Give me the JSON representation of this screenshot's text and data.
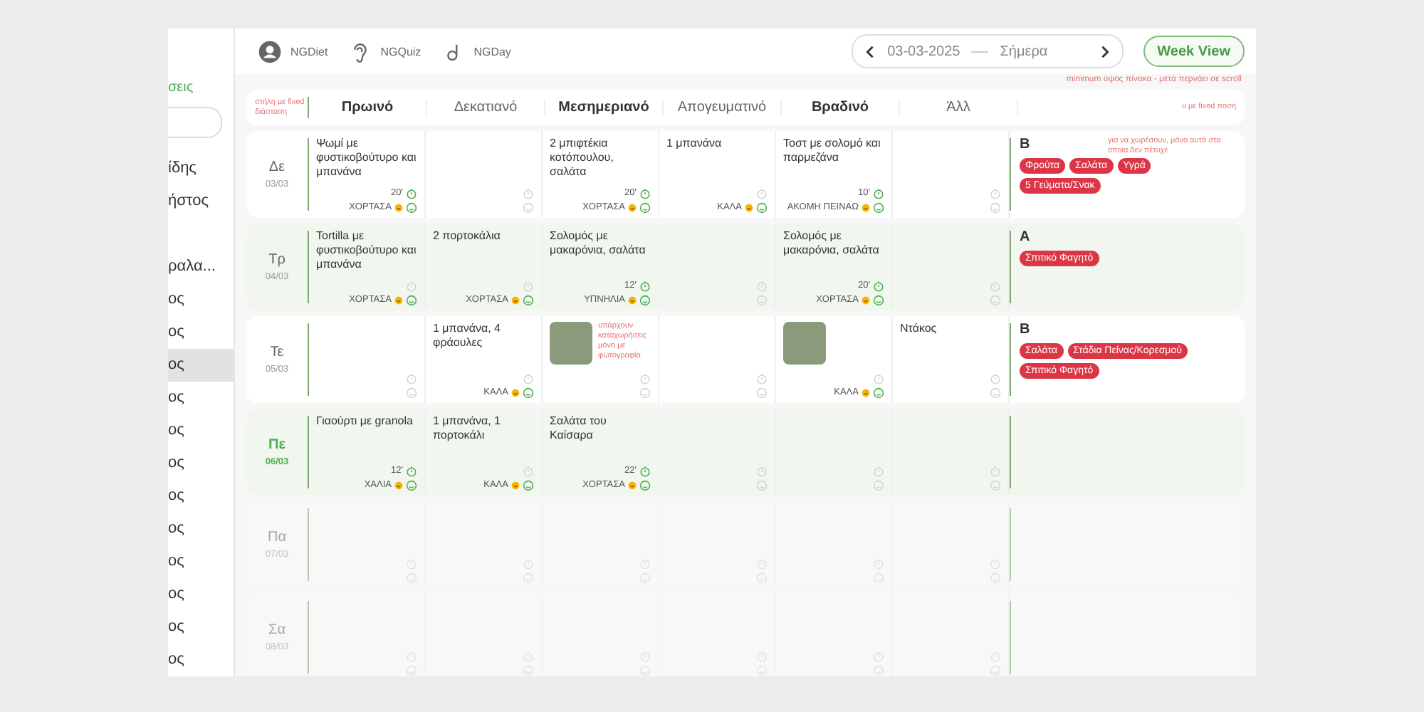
{
  "sidebar": {
    "heading": "σεις",
    "items": [
      {
        "label": "ίδης",
        "selected": false
      },
      {
        "label": "ήστος",
        "selected": false
      },
      {
        "label": "ραλα...",
        "selected": false
      },
      {
        "label": "ος",
        "selected": false
      },
      {
        "label": "ος",
        "selected": false
      },
      {
        "label": "ος",
        "selected": true
      },
      {
        "label": "ος",
        "selected": false
      },
      {
        "label": "ος",
        "selected": false
      },
      {
        "label": "ος",
        "selected": false
      },
      {
        "label": "ος",
        "selected": false
      },
      {
        "label": "ος",
        "selected": false
      },
      {
        "label": "ος",
        "selected": false
      },
      {
        "label": "ος",
        "selected": false
      },
      {
        "label": "ος",
        "selected": false
      },
      {
        "label": "ος",
        "selected": false
      }
    ]
  },
  "top_nav": [
    {
      "label": "NGDiet",
      "kind": "avatar"
    },
    {
      "label": "NGQuiz",
      "kind": "ear"
    },
    {
      "label": "NGDay",
      "kind": "letter"
    }
  ],
  "date_picker": {
    "date": "03-03-2025",
    "today_label": "Σήμερα"
  },
  "view_button": "Week View",
  "height_note": "minimum ύψος πίνακα - μετά περνάει σε scroll",
  "table": {
    "first_column_note": "στήλη με fixed διάσταση",
    "last_column_note": "υ με fixed ποση",
    "columns": [
      {
        "label": "Πρωινό",
        "bold": true
      },
      {
        "label": "Δεκατιανό",
        "bold": false
      },
      {
        "label": "Μεσημεριανό",
        "bold": true
      },
      {
        "label": "Απογευματινό",
        "bold": false
      },
      {
        "label": "Βραδινό",
        "bold": true
      },
      {
        "label": "Άλλ",
        "bold": false
      }
    ],
    "rows": [
      {
        "day": "Δε",
        "date": "03/03",
        "today": false,
        "shaded": false,
        "faded": false,
        "cells": [
          {
            "kind": "text",
            "text": "Ψωμί με φυστικοβούτυρο και μπανάνα",
            "time": "20'",
            "feeling": "ΧΟΡΤΑΣΑ"
          },
          {
            "kind": "empty"
          },
          {
            "kind": "text",
            "text": "2 μπιφτέκια κοτόπουλου, σαλάτα",
            "time": "20'",
            "feeling": "ΧΟΡΤΑΣΑ"
          },
          {
            "kind": "text",
            "text": "1 μπανάνα",
            "feeling": "ΚΑΛΑ"
          },
          {
            "kind": "text",
            "text": "Τοστ με σολομό και παρμεζάνα",
            "time": "10'",
            "feeling": "ΑΚΟΜΗ ΠΕΙΝΑΩ"
          },
          {
            "kind": "empty"
          }
        ],
        "grade": "B",
        "note": "για να χωρέσουν, μόνο αυτά στα οποία δεν πέτυχε",
        "tags": [
          "Φρούτα",
          "Σαλάτα",
          "Υγρά",
          "5 Γεύματα/Σνακ"
        ]
      },
      {
        "day": "Τρ",
        "date": "04/03",
        "today": false,
        "shaded": true,
        "faded": false,
        "cells": [
          {
            "kind": "text",
            "text": "Tortilla με φυστικοβούτυρο και μπανάνα",
            "feeling": "ΧΟΡΤΑΣΑ"
          },
          {
            "kind": "text",
            "text": "2 πορτοκάλια",
            "feeling": "ΧΟΡΤΑΣΑ"
          },
          {
            "kind": "text",
            "text": "Σολομός με μακαρόνια, σαλάτα",
            "time": "12'",
            "feeling": "ΥΠΝΗΛΙΑ"
          },
          {
            "kind": "empty"
          },
          {
            "kind": "text",
            "text": "Σολομός με μακαρόνια, σαλάτα",
            "time": "20'",
            "feeling": "ΧΟΡΤΑΣΑ"
          },
          {
            "kind": "empty"
          }
        ],
        "grade": "A",
        "tags": [
          "Σπιτικό Φαγητό"
        ]
      },
      {
        "day": "Τε",
        "date": "05/03",
        "today": false,
        "shaded": false,
        "faded": false,
        "cells": [
          {
            "kind": "empty"
          },
          {
            "kind": "text",
            "text": "1 μπανάνα, 4 φράουλες",
            "feeling": "ΚΑΛΑ"
          },
          {
            "kind": "photo",
            "note": "υπάρχουν καταχωρήσεις μόνο με φωτογραφία"
          },
          {
            "kind": "empty"
          },
          {
            "kind": "photo",
            "feeling": "ΚΑΛΑ"
          },
          {
            "kind": "text",
            "text": "Ντάκος"
          }
        ],
        "grade": "B",
        "tags": [
          "Σαλάτα",
          "Στάδια Πείνας/Κορεσμού",
          "Σπιτικό Φαγητό"
        ]
      },
      {
        "day": "Πε",
        "date": "06/03",
        "today": true,
        "shaded": true,
        "faded": false,
        "cells": [
          {
            "kind": "text",
            "text": "Γιαούρτι με granola",
            "time": "12'",
            "feeling": "ΧΑΛΙΑ"
          },
          {
            "kind": "text",
            "text": "1 μπανάνα, 1 πορτοκάλι",
            "feeling": "ΚΑΛΑ"
          },
          {
            "kind": "text",
            "text": "Σαλάτα του Καίσαρα",
            "time": "22'",
            "feeling": "ΧΟΡΤΑΣΑ"
          },
          {
            "kind": "empty"
          },
          {
            "kind": "empty"
          },
          {
            "kind": "empty"
          }
        ]
      },
      {
        "day": "Πα",
        "date": "07/03",
        "today": false,
        "shaded": false,
        "faded": true,
        "cells": [
          {
            "kind": "empty"
          },
          {
            "kind": "empty"
          },
          {
            "kind": "empty"
          },
          {
            "kind": "empty"
          },
          {
            "kind": "empty"
          },
          {
            "kind": "empty"
          }
        ]
      },
      {
        "day": "Σα",
        "date": "08/03",
        "today": false,
        "shaded": false,
        "faded": true,
        "cells": [
          {
            "kind": "empty"
          },
          {
            "kind": "empty"
          },
          {
            "kind": "empty"
          },
          {
            "kind": "empty"
          },
          {
            "kind": "empty"
          },
          {
            "kind": "empty"
          }
        ]
      }
    ]
  }
}
